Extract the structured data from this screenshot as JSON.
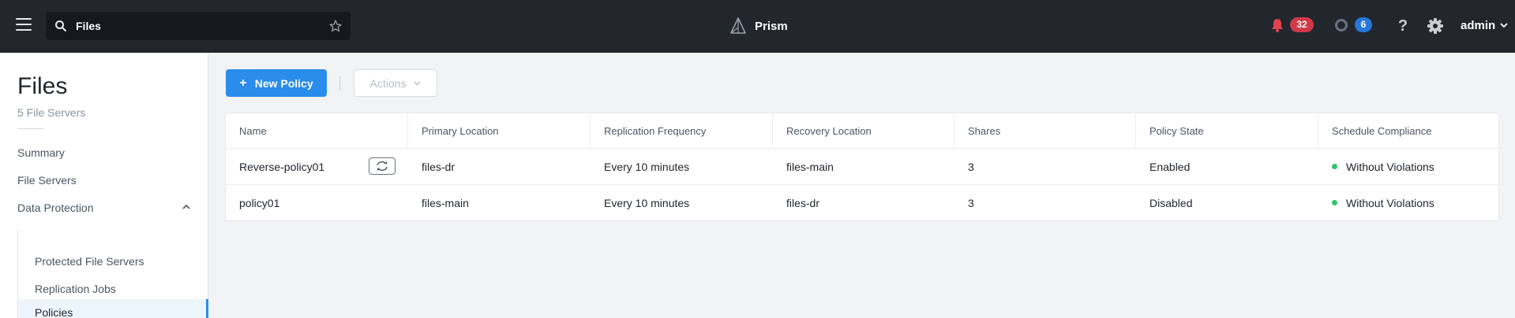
{
  "topbar": {
    "search": {
      "value": "Files",
      "placeholder": "Search"
    },
    "brand": "Prism",
    "alerts_count": "32",
    "tasks_count": "6",
    "help_symbol": "?",
    "user": "admin",
    "colors": {
      "bar": "#22272e",
      "alert_badge": "#cf3a48",
      "task_badge": "#2577d9"
    }
  },
  "sidebar": {
    "title": "Files",
    "subtitle": "5 File Servers",
    "items": [
      {
        "label": "Summary"
      },
      {
        "label": "File Servers"
      },
      {
        "label": "Data Protection",
        "expanded": true
      }
    ],
    "sub_items": [
      {
        "label": "Protected File Servers"
      },
      {
        "label": "Replication Jobs"
      },
      {
        "label": "Policies",
        "active": true
      }
    ]
  },
  "toolbar": {
    "new_policy_label": "New Policy",
    "actions_label": "Actions",
    "accent": "#2a8ceb"
  },
  "table": {
    "columns": [
      "Name",
      "Primary Location",
      "Replication Frequency",
      "Recovery Location",
      "Shares",
      "Policy State",
      "Schedule Compliance"
    ],
    "rows": [
      {
        "name": "Reverse-policy01",
        "primary": "files-dr",
        "frequency": "Every 10 minutes",
        "recovery": "files-main",
        "shares": "3",
        "state": "Enabled",
        "compliance": "Without Violations",
        "icon": "sync-icon"
      },
      {
        "name": "policy01",
        "primary": "files-main",
        "frequency": "Every 10 minutes",
        "recovery": "files-dr",
        "shares": "3",
        "state": "Disabled",
        "compliance": "Without Violations"
      }
    ],
    "compliance_color": "#31c46b"
  }
}
